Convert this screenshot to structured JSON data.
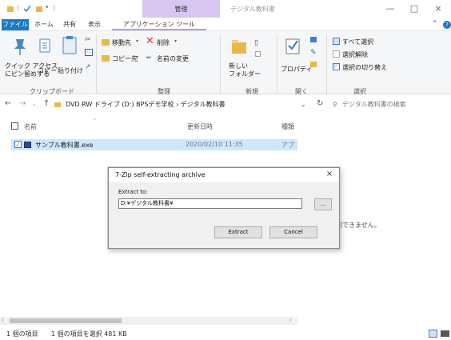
{
  "titlebar": {
    "context_tab_title": "管理",
    "window_title": "デジタル教科書",
    "minimize": "—",
    "maximize": "□",
    "close": "×"
  },
  "ribbon_tabs": {
    "file": "ファイル",
    "home": "ホーム",
    "share": "共有",
    "view": "表示",
    "app_tools": "アプリケーション ツール"
  },
  "ribbon": {
    "clipboard": {
      "pin_quick_access": "クイック アクセス\nにピン留めする",
      "copy": "コピー",
      "paste": "貼り付け",
      "label": "クリップボード"
    },
    "organize": {
      "move_to": "移動先",
      "copy_to": "コピー先",
      "delete": "削除",
      "rename": "名前の変更",
      "label": "整理"
    },
    "new": {
      "new_folder": "新しい\nフォルダー",
      "label": "新規"
    },
    "open": {
      "properties": "プロパティ",
      "label": "開く"
    },
    "select": {
      "select_all": "すべて選択",
      "select_none": "選択解除",
      "invert": "選択の切り替え",
      "label": "選択"
    }
  },
  "nav": {
    "address": "DVD RW ドライブ (D:) BPSデモ学校 › デジタル教科書",
    "search_placeholder": "デジタル教科書の検索"
  },
  "columns": {
    "name": "名前",
    "date": "更新日時",
    "type": "種類"
  },
  "files": [
    {
      "name": "サンプル教科書.exe",
      "date": "2020/02/10 11:35",
      "type": "アプ"
    }
  ],
  "preview": {
    "message": "プレビューを利用できません。"
  },
  "status": {
    "count": "1 個の項目",
    "selected": "1 個の項目を選択  481 KB"
  },
  "dialog": {
    "title": "7-Zip self-extracting archive",
    "extract_to_label": "Extract to:",
    "path": "D:¥デジタル教科書¥",
    "browse": "...",
    "extract_button": "Extract",
    "cancel_button": "Cancel",
    "close": "×"
  }
}
